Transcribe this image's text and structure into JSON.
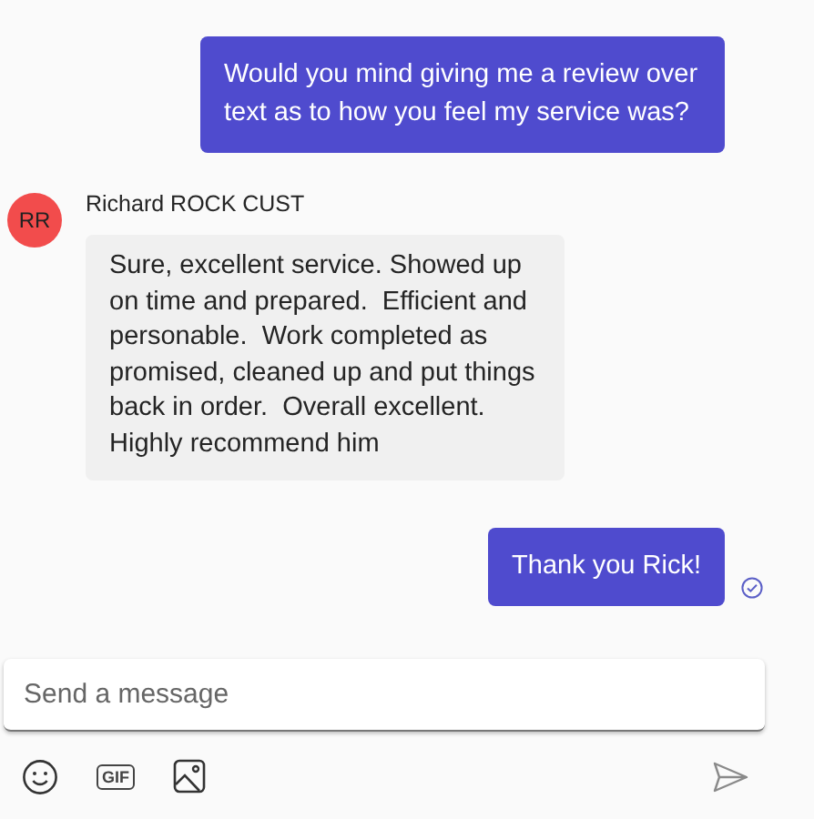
{
  "messages": [
    {
      "kind": "outgoing",
      "text": "Would you mind giving me a review over text as to how you feel my service was?",
      "delivered": false
    },
    {
      "kind": "incoming",
      "sender": "Richard ROCK CUST",
      "initials": "RR",
      "text": "Sure, excellent service. Showed up on time and prepared.  Efficient and personable.  Work completed as promised, cleaned up and put things back in order.  Overall excellent.  Highly recommend him"
    },
    {
      "kind": "outgoing",
      "text": "Thank you Rick!",
      "delivered": true
    }
  ],
  "composer": {
    "placeholder": "Send a message",
    "gif_label": "GIF"
  }
}
